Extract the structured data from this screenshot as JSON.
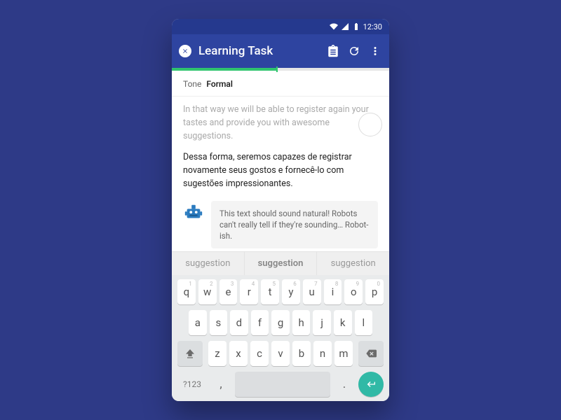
{
  "status": {
    "time": "12:30"
  },
  "appbar": {
    "title": "Learning Task"
  },
  "tone": {
    "label": "Tone",
    "value": "Formal"
  },
  "source_text": "In that way we will be able to register again your tastes and provide you with awesome suggestions.",
  "target_text": "Dessa forma, seremos capazes de registrar novamente seus gostos e fornecê-lo com sugestões impressionantes.",
  "hint": "This text should sound natural! Robots can't really tell if they're sounding… Robot-ish.",
  "suggestions": [
    "suggestion",
    "suggestion",
    "suggestion"
  ],
  "keyboard": {
    "row1": [
      "q",
      "w",
      "e",
      "r",
      "t",
      "y",
      "u",
      "i",
      "o",
      "p"
    ],
    "row1_nums": [
      "1",
      "2",
      "3",
      "4",
      "5",
      "6",
      "7",
      "8",
      "9",
      "0"
    ],
    "row2": [
      "a",
      "s",
      "d",
      "f",
      "g",
      "h",
      "j",
      "k",
      "l"
    ],
    "row3": [
      "z",
      "x",
      "c",
      "v",
      "b",
      "n",
      "m"
    ],
    "sym": "?123"
  }
}
